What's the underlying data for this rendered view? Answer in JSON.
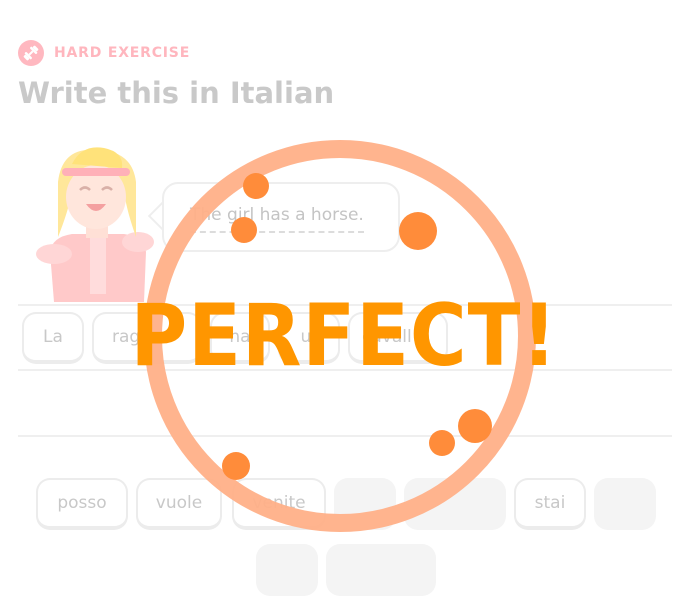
{
  "header": {
    "badge_label": "HARD EXERCISE",
    "badge_icon": "dumbbell-icon",
    "title": "Write this in Italian"
  },
  "prompt": {
    "sentence": "The girl has a horse."
  },
  "answer_tiles": [
    "La",
    "raga",
    "ha",
    "un",
    "cavall"
  ],
  "word_bank": [
    {
      "label": "posso",
      "used": false
    },
    {
      "label": "vuole",
      "used": false
    },
    {
      "label": "venite",
      "used": false
    },
    {
      "label": "",
      "used": true
    },
    {
      "label": "",
      "used": true
    },
    {
      "label": "stai",
      "used": false
    },
    {
      "label": "",
      "used": true
    },
    {
      "label": "",
      "used": true
    },
    {
      "label": "",
      "used": true
    }
  ],
  "feedback": {
    "message": "PERFECT!",
    "color": "#ff9600",
    "ring_color": "#ffb088",
    "dot_color": "#ff8c3a"
  },
  "colors": {
    "badge": "#ffb8c0",
    "title": "#c9c9c9"
  }
}
